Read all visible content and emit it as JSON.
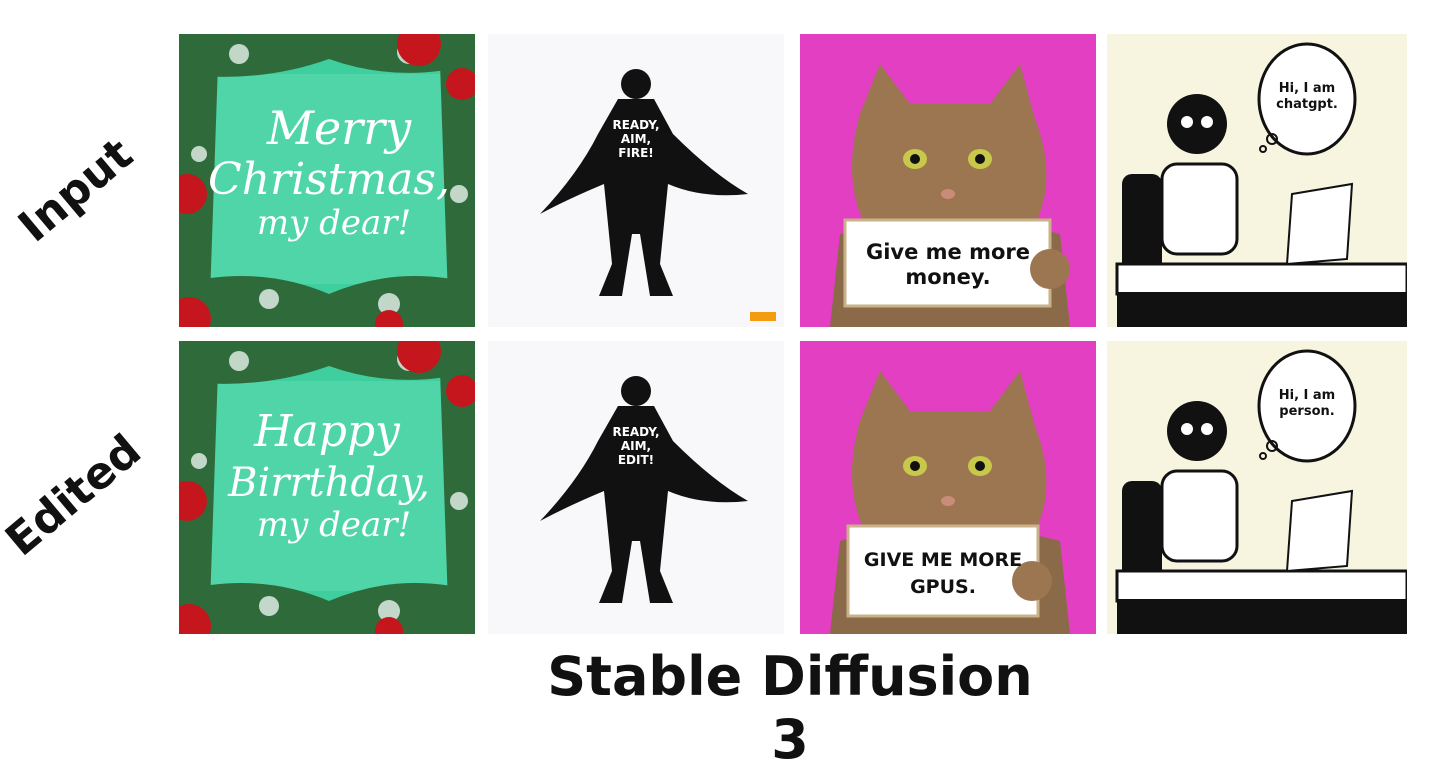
{
  "row_labels": {
    "input": "Input",
    "edited": "Edited"
  },
  "caption": "Stable Diffusion 3",
  "input": {
    "christmas": {
      "line1": "Merry",
      "line2": "Christmas,",
      "line3": "my dear!"
    },
    "hero": {
      "line1": "READY,",
      "line2": "AIM,",
      "line3": "FIRE!"
    },
    "cat": {
      "line1": "Give me more",
      "line2": "money."
    },
    "robot": {
      "line1": "Hi, I am",
      "line2": "chatgpt."
    }
  },
  "edited": {
    "christmas": {
      "line1": "Happy",
      "line2": "Birrthday,",
      "line3": "my dear!"
    },
    "hero": {
      "line1": "READY,",
      "line2": "AIM,",
      "line3": "EDIT!"
    },
    "cat": {
      "line1": "GIVE ME MORE",
      "line2": "GPUS."
    },
    "robot": {
      "line1": "Hi, I am",
      "line2": "person."
    }
  },
  "colors": {
    "christmas_bg": "#3fcf9f",
    "cat_bg": "#e23fc2",
    "robot_bg": "#f7f4df"
  }
}
